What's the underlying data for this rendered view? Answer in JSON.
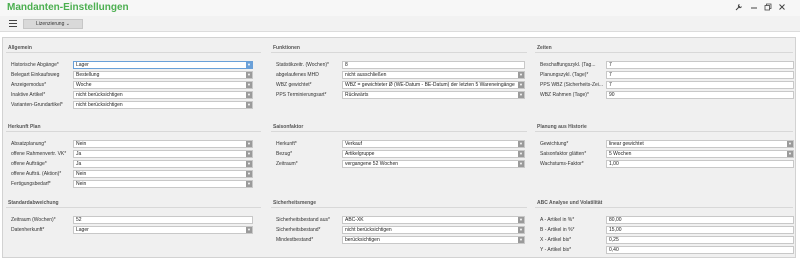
{
  "window": {
    "title": "Mandanten-Einstellungen",
    "controls": [
      "wrench-icon",
      "minimize-icon",
      "restore-icon",
      "close-icon"
    ]
  },
  "toolbar": {
    "license_label": "Lizenzierung",
    "license_icon": "chevron-down-icon"
  },
  "sections": {
    "allgemein": {
      "title": "Allgemein",
      "rows": [
        {
          "label": "Historische Abgänge*",
          "value": "Lager",
          "dropdown": true,
          "focused": true
        },
        {
          "label": "Belegart Einkaufsweg",
          "value": "Bestellung",
          "dropdown": true
        },
        {
          "label": "Anzeigemodus*",
          "value": "Woche",
          "dropdown": true
        },
        {
          "label": "Inaktive Artikel*",
          "value": "nicht berücksichtigen",
          "dropdown": true
        },
        {
          "label": "Varianten-Grundartikel*",
          "value": "nicht berücksichtigen",
          "dropdown": true
        }
      ]
    },
    "funktionen": {
      "title": "Funktionen",
      "rows": [
        {
          "label": "Statistikzeitr. (Wochen)*",
          "value": "8",
          "dropdown": false
        },
        {
          "label": "abgelaufenes MHD",
          "value": "nicht ausschließen",
          "dropdown": true
        },
        {
          "label": "WBZ gewichtet*",
          "value": "WBZ = gewichteter Ø (WE-Datum - BE-Datum) der letzten 5 Wareneingänge",
          "dropdown": true
        },
        {
          "label": "PPS Terminierungsart*",
          "value": "Rückwärts",
          "dropdown": true
        }
      ]
    },
    "zeiten": {
      "title": "Zeiten",
      "rows": [
        {
          "label": "Beschaffungszykl. (Tag...",
          "value": "7",
          "dropdown": false
        },
        {
          "label": "Planungszykl. (Tage)*",
          "value": "7",
          "dropdown": false
        },
        {
          "label": "PPS WBZ (Sicherheits-Zei...",
          "value": "7",
          "dropdown": false
        },
        {
          "label": "WBZ Rahmen (Tage)*",
          "value": "90",
          "dropdown": false
        }
      ]
    },
    "herkunft": {
      "title": "Herkunft Plan",
      "rows": [
        {
          "label": "Absatzplanung*",
          "value": "Nein",
          "dropdown": true
        },
        {
          "label": "offene Rahmenvertr. VK*",
          "value": "Ja",
          "dropdown": true
        },
        {
          "label": "offene Aufträge*",
          "value": "Ja",
          "dropdown": true
        },
        {
          "label": "offene Aufträ. (Aktion)*",
          "value": "Nein",
          "dropdown": true
        },
        {
          "label": "Fertigungsbedarf*",
          "value": "Nein",
          "dropdown": true
        }
      ]
    },
    "saisonfaktor": {
      "title": "Saisonfaktor",
      "rows": [
        {
          "label": "Herkunft*",
          "value": "Verkauf",
          "dropdown": true
        },
        {
          "label": "Bezug*",
          "value": "Artikelgruppe",
          "dropdown": true
        },
        {
          "label": "Zeitraum*",
          "value": "vergangene 52 Wochen",
          "dropdown": true
        }
      ]
    },
    "planung": {
      "title": "Planung aus Historie",
      "rows": [
        {
          "label": "Gewichtung*",
          "value": "linear gewichtet",
          "dropdown": true
        },
        {
          "label": "Saisonfaktor glätten*",
          "value": "5 Wochen",
          "dropdown": true
        },
        {
          "label": "Wachstums-Faktor*",
          "value": "1,00",
          "dropdown": false
        }
      ]
    },
    "standardabweichung": {
      "title": "Standardabweichung",
      "rows": [
        {
          "label": "Zeitraum (Wochen)*",
          "value": "52",
          "dropdown": false
        },
        {
          "label": "Datenherkunft*",
          "value": "Lager",
          "dropdown": true
        }
      ]
    },
    "sicherheitsmenge": {
      "title": "Sicherheitsmenge",
      "rows": [
        {
          "label": "Sicherheitsbestand aus*",
          "value": "ABC-XK",
          "dropdown": true
        },
        {
          "label": "Sicherheitsbestand*",
          "value": "nicht berücksichtigen",
          "dropdown": true
        },
        {
          "label": "Mindestbestand*",
          "value": "berücksichtigen",
          "dropdown": true
        }
      ]
    },
    "abc": {
      "title": "ABC Analyse und Volatilität",
      "rows": [
        {
          "label": "A - Artikel in %*",
          "value": "80,00",
          "dropdown": false
        },
        {
          "label": "B - Artikel in %*",
          "value": "15,00",
          "dropdown": false
        },
        {
          "label": "X - Artikel bis*",
          "value": "0,25",
          "dropdown": false
        },
        {
          "label": "Y - Artikel bis*",
          "value": "0,40",
          "dropdown": false
        }
      ]
    }
  },
  "colors": {
    "title": "#4caf50",
    "focus_border": "#6aa0d8",
    "panel_bg": "#f0f0f0"
  }
}
